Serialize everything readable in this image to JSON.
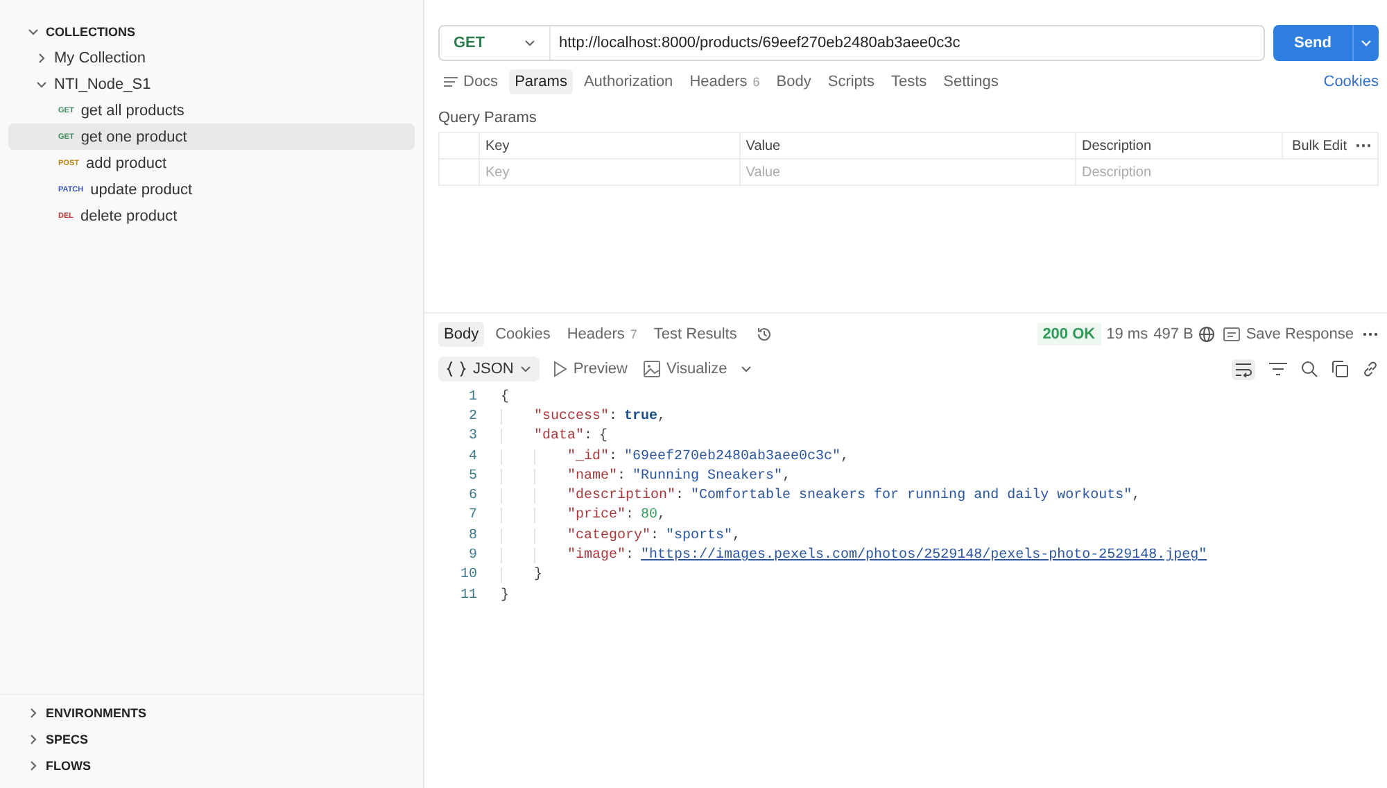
{
  "sidebar": {
    "sections": [
      {
        "label": "COLLECTIONS",
        "expanded": true,
        "children": [
          {
            "label": "My Collection",
            "expanded": false
          },
          {
            "label": "NTI_Node_S1",
            "expanded": true,
            "children": [
              {
                "method": "GET",
                "label": "get all products",
                "selected": false
              },
              {
                "method": "GET",
                "label": "get one product",
                "selected": true
              },
              {
                "method": "POST",
                "label": "add product",
                "selected": false
              },
              {
                "method": "PATCH",
                "label": "update product",
                "selected": false
              },
              {
                "method": "DEL",
                "label": "delete product",
                "selected": false
              }
            ]
          }
        ]
      }
    ],
    "bottom_sections": [
      {
        "label": "ENVIRONMENTS",
        "expanded": false
      },
      {
        "label": "SPECS",
        "expanded": false
      },
      {
        "label": "FLOWS",
        "expanded": false
      }
    ]
  },
  "request": {
    "method": "GET",
    "url": "http://localhost:8000/products/69eef270eb2480ab3aee0c3c",
    "send": "Send",
    "tabs": [
      {
        "label": "Docs",
        "selected": false,
        "kind": "docs"
      },
      {
        "label": "Params",
        "selected": true
      },
      {
        "label": "Authorization",
        "selected": false
      },
      {
        "label": "Headers",
        "count": "6",
        "selected": false
      },
      {
        "label": "Body",
        "selected": false
      },
      {
        "label": "Scripts",
        "selected": false
      },
      {
        "label": "Tests",
        "selected": false
      },
      {
        "label": "Settings",
        "selected": false
      }
    ],
    "cookies": "Cookies",
    "query_params": {
      "title": "Query Params",
      "columns": [
        "Key",
        "Value",
        "Description"
      ],
      "bulk_edit": "Bulk Edit",
      "placeholders": [
        "Key",
        "Value",
        "Description"
      ]
    }
  },
  "response": {
    "tabs": [
      {
        "label": "Body",
        "selected": true
      },
      {
        "label": "Cookies",
        "selected": false
      },
      {
        "label": "Headers",
        "count": "7",
        "selected": false
      },
      {
        "label": "Test Results",
        "selected": false
      }
    ],
    "status": "200 OK",
    "time": "19 ms",
    "size": "497 B",
    "save": "Save Response",
    "format": "JSON",
    "views": [
      {
        "label": "Preview",
        "kind": "preview"
      },
      {
        "label": "Visualize",
        "kind": "visualize"
      }
    ],
    "lines": [
      {
        "number": "1",
        "tokens": [
          {
            "kind": "punct",
            "text": "{"
          }
        ],
        "children": [
          {
            "number": "2",
            "tokens": [
              {
                "kind": "key",
                "text": "\"success\""
              },
              {
                "kind": "punct",
                "text": ":"
              },
              {
                "kind": "bool",
                "text": "true"
              },
              {
                "kind": "punct",
                "text": ","
              }
            ]
          },
          {
            "number": "3",
            "tokens": [
              {
                "kind": "key",
                "text": "\"data\""
              },
              {
                "kind": "punct",
                "text": ":"
              },
              {
                "kind": "punct",
                "text": "{"
              }
            ],
            "children": [
              {
                "number": "4",
                "tokens": [
                  {
                    "kind": "key",
                    "text": "\"_id\""
                  },
                  {
                    "kind": "punct",
                    "text": ":"
                  },
                  {
                    "kind": "string",
                    "text": "\"69eef270eb2480ab3aee0c3c\""
                  },
                  {
                    "kind": "punct",
                    "text": ","
                  }
                ]
              },
              {
                "number": "5",
                "tokens": [
                  {
                    "kind": "key",
                    "text": "\"name\""
                  },
                  {
                    "kind": "punct",
                    "text": ":"
                  },
                  {
                    "kind": "string",
                    "text": "\"Running Sneakers\""
                  },
                  {
                    "kind": "punct",
                    "text": ","
                  }
                ]
              },
              {
                "number": "6",
                "tokens": [
                  {
                    "kind": "key",
                    "text": "\"description\""
                  },
                  {
                    "kind": "punct",
                    "text": ":"
                  },
                  {
                    "kind": "string",
                    "text": "\"Comfortable sneakers for running and daily workouts\""
                  },
                  {
                    "kind": "punct",
                    "text": ","
                  }
                ]
              },
              {
                "number": "7",
                "tokens": [
                  {
                    "kind": "key",
                    "text": "\"price\""
                  },
                  {
                    "kind": "punct",
                    "text": ":"
                  },
                  {
                    "kind": "number",
                    "text": "80"
                  },
                  {
                    "kind": "punct",
                    "text": ","
                  }
                ]
              },
              {
                "number": "8",
                "tokens": [
                  {
                    "kind": "key",
                    "text": "\"category\""
                  },
                  {
                    "kind": "punct",
                    "text": ":"
                  },
                  {
                    "kind": "string",
                    "text": "\"sports\""
                  },
                  {
                    "kind": "punct",
                    "text": ","
                  }
                ]
              },
              {
                "number": "9",
                "tokens": [
                  {
                    "kind": "key",
                    "text": "\"image\""
                  },
                  {
                    "kind": "punct",
                    "text": ":"
                  },
                  {
                    "kind": "link",
                    "text": "\"https://images.pexels.com/photos/2529148/pexels-photo-2529148.jpeg\""
                  }
                ]
              }
            ]
          },
          {
            "number": "10",
            "tokens": [
              {
                "kind": "punct",
                "text": "}"
              }
            ]
          }
        ]
      },
      {
        "number": "11",
        "tokens": [
          {
            "kind": "punct",
            "text": "}"
          }
        ]
      }
    ]
  }
}
